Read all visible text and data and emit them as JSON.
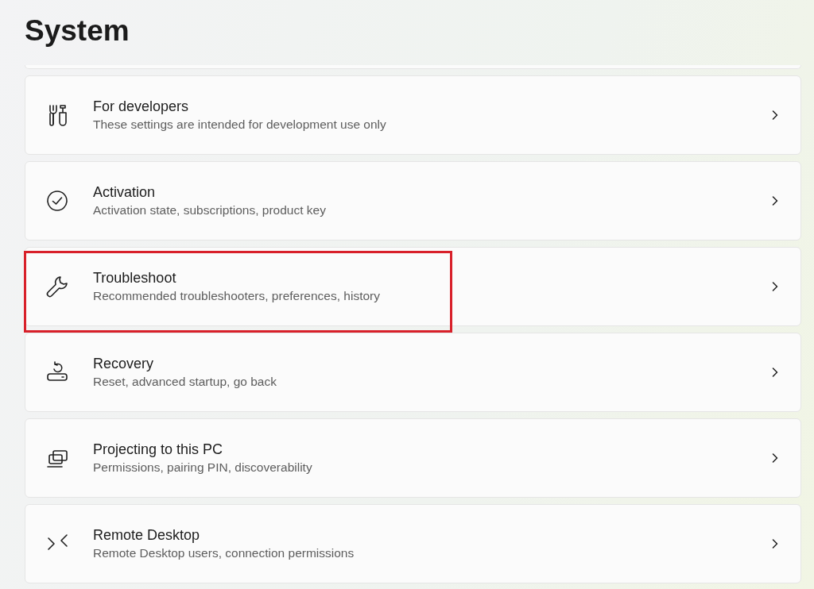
{
  "page": {
    "title": "System"
  },
  "items": [
    {
      "kind": "developers",
      "title": "For developers",
      "description": "These settings are intended for development use only",
      "highlighted": false
    },
    {
      "kind": "activation",
      "title": "Activation",
      "description": "Activation state, subscriptions, product key",
      "highlighted": false
    },
    {
      "kind": "troubleshoot",
      "title": "Troubleshoot",
      "description": "Recommended troubleshooters, preferences, history",
      "highlighted": true
    },
    {
      "kind": "recovery",
      "title": "Recovery",
      "description": "Reset, advanced startup, go back",
      "highlighted": false
    },
    {
      "kind": "projecting",
      "title": "Projecting to this PC",
      "description": "Permissions, pairing PIN, discoverability",
      "highlighted": false
    },
    {
      "kind": "remote",
      "title": "Remote Desktop",
      "description": "Remote Desktop users, connection permissions",
      "highlighted": false
    }
  ]
}
